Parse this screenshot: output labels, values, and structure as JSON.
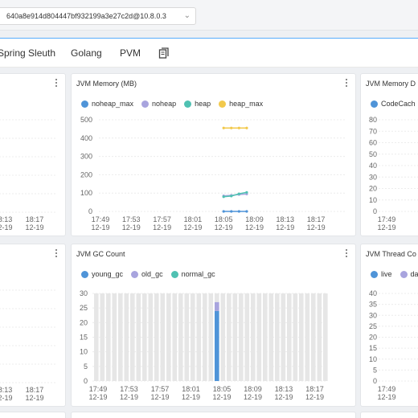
{
  "header": {
    "instance": "640a8e914d804447bf932199a3e27c2d@10.8.0.3"
  },
  "tabs": [
    "Spring Sleuth",
    "Golang",
    "PVM"
  ],
  "colors": {
    "blue": "#4f94d8",
    "purple": "#a8a4de",
    "teal": "#4fc1b2",
    "yellow": "#f2c94c",
    "accent": "#1890ff"
  },
  "panels": {
    "jvm_memory": {
      "title": "JVM Memory (MB)"
    },
    "jvm_memory_detail": {
      "title": "JVM Memory D"
    },
    "jvm_gc": {
      "title": "JVM GC Count"
    },
    "jvm_thread": {
      "title": "JVM Thread Co"
    }
  },
  "chart_data": [
    {
      "panel": "jvm_memory",
      "type": "line",
      "title": "JVM Memory (MB)",
      "x": [
        "17:49 12-19",
        "17:53 12-19",
        "17:57 12-19",
        "18:01 12-19",
        "18:05 12-19",
        "18:09 12-19",
        "18:13 12-19",
        "18:17 12-19"
      ],
      "ylim": [
        0,
        500
      ],
      "yticks": [
        0,
        100,
        200,
        300,
        400,
        500
      ],
      "series": [
        {
          "name": "noheap_max",
          "color": "#4f94d8",
          "points": [
            [
              4,
              0
            ],
            [
              4.25,
              0
            ],
            [
              4.5,
              0
            ],
            [
              4.75,
              0
            ]
          ]
        },
        {
          "name": "noheap",
          "color": "#a8a4de",
          "points": [
            [
              4,
              85
            ],
            [
              4.25,
              88
            ],
            [
              4.5,
              92
            ],
            [
              4.75,
              95
            ]
          ]
        },
        {
          "name": "heap",
          "color": "#4fc1b2",
          "points": [
            [
              4,
              80
            ],
            [
              4.25,
              84
            ],
            [
              4.5,
              96
            ],
            [
              4.75,
              104
            ]
          ]
        },
        {
          "name": "heap_max",
          "color": "#f2c94c",
          "points": [
            [
              4,
              455
            ],
            [
              4.25,
              455
            ],
            [
              4.5,
              455
            ],
            [
              4.75,
              455
            ]
          ]
        }
      ]
    },
    {
      "panel": "jvm_memory_detail",
      "type": "line",
      "x": [
        "17:49 12-19"
      ],
      "ylim": [
        0,
        80
      ],
      "yticks": [
        0,
        10,
        20,
        30,
        40,
        50,
        60,
        70,
        80
      ],
      "series": [
        {
          "name": "CodeCach",
          "color": "#4f94d8"
        }
      ]
    },
    {
      "panel": "jvm_gc",
      "type": "bar",
      "title": "JVM GC Count",
      "x": [
        "17:49 12-19",
        "17:53 12-19",
        "17:57 12-19",
        "18:01 12-19",
        "18:05 12-19",
        "18:09 12-19",
        "18:13 12-19",
        "18:17 12-19"
      ],
      "ylim": [
        0,
        30
      ],
      "yticks": [
        0,
        5,
        10,
        15,
        20,
        25,
        30
      ],
      "series": [
        {
          "name": "young_gc",
          "color": "#4f94d8",
          "values_at_18_05": 24
        },
        {
          "name": "old_gc",
          "color": "#a8a4de",
          "values_at_18_05": 3
        },
        {
          "name": "normal_gc",
          "color": "#4fc1b2",
          "values_at_18_05": 0
        }
      ]
    },
    {
      "panel": "jvm_thread",
      "type": "line",
      "x": [
        "17:49 12-19"
      ],
      "ylim": [
        0,
        40
      ],
      "yticks": [
        0,
        5,
        10,
        15,
        20,
        25,
        30,
        35,
        40
      ],
      "series": [
        {
          "name": "live",
          "color": "#4f94d8"
        },
        {
          "name": "da",
          "color": "#a8a4de"
        }
      ]
    }
  ],
  "left_panels_xticks": [
    "18:13 12-19",
    "18:17 12-19"
  ]
}
